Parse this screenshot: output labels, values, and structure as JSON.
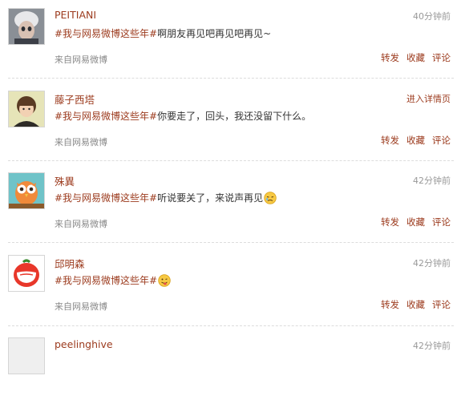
{
  "posts": [
    {
      "user": "PEITIANI",
      "time": "40分钟前",
      "hashtag": "#我与网易微博这些年#",
      "message": "啊朋友再见吧再见吧再见~",
      "source": "来自网易微博",
      "actions": [
        "转发",
        "收藏",
        "评论"
      ]
    },
    {
      "user": "藤子西塔",
      "time": "进入详情页",
      "hashtag": "#我与网易微博这些年#",
      "message": "你要走了，回头，我还没留下什么。",
      "source": "来自网易微博",
      "actions": [
        "转发",
        "收藏",
        "评论"
      ]
    },
    {
      "user": "殊異",
      "time": "42分钟前",
      "hashtag": "#我与网易微博这些年#",
      "message": "听说要关了，来说声再见",
      "source": "来自网易微博",
      "actions": [
        "转发",
        "收藏",
        "评论"
      ]
    },
    {
      "user": "邱明森",
      "time": "42分钟前",
      "hashtag": "#我与网易微博这些年#",
      "message": "",
      "source": "来自网易微博",
      "actions": [
        "转发",
        "收藏",
        "评论"
      ]
    },
    {
      "user": "peelinghive",
      "time": "42分钟前"
    }
  ]
}
